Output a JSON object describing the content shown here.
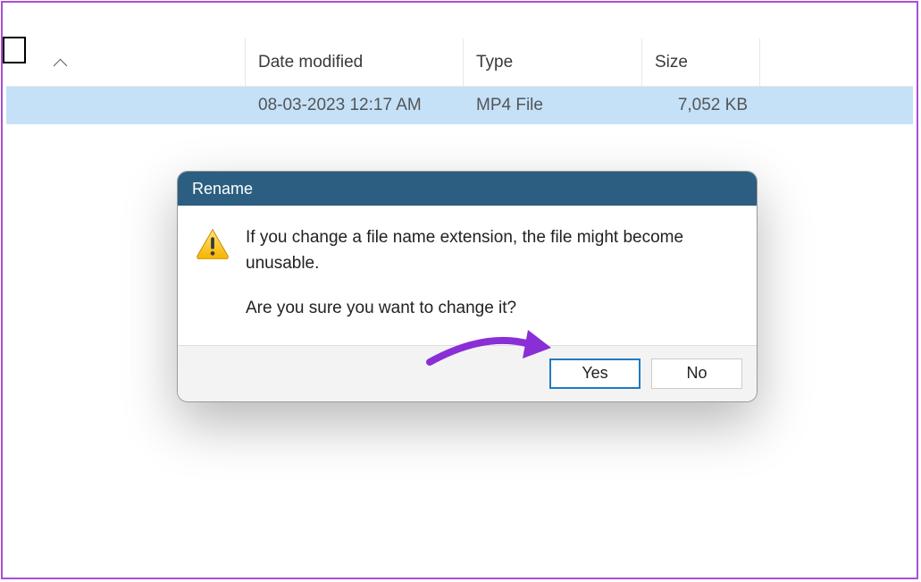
{
  "columns": {
    "name_sort_indicator": "asc",
    "date_modified": "Date modified",
    "type": "Type",
    "size": "Size"
  },
  "file_row": {
    "date_modified": "08-03-2023 12:17 AM",
    "type": "MP4 File",
    "size": "7,052 KB"
  },
  "dialog": {
    "title": "Rename",
    "line1": "If you change a file name extension, the file might become unusable.",
    "line2": "Are you sure you want to change it?",
    "yes_label": "Yes",
    "no_label": "No"
  },
  "colors": {
    "frame_border": "#a84fd6",
    "selection_bg": "#c4e1f8",
    "dialog_title_bg": "#2b5e80",
    "arrow": "#8a2ed6",
    "primary_btn_border": "#1f7bbf"
  }
}
